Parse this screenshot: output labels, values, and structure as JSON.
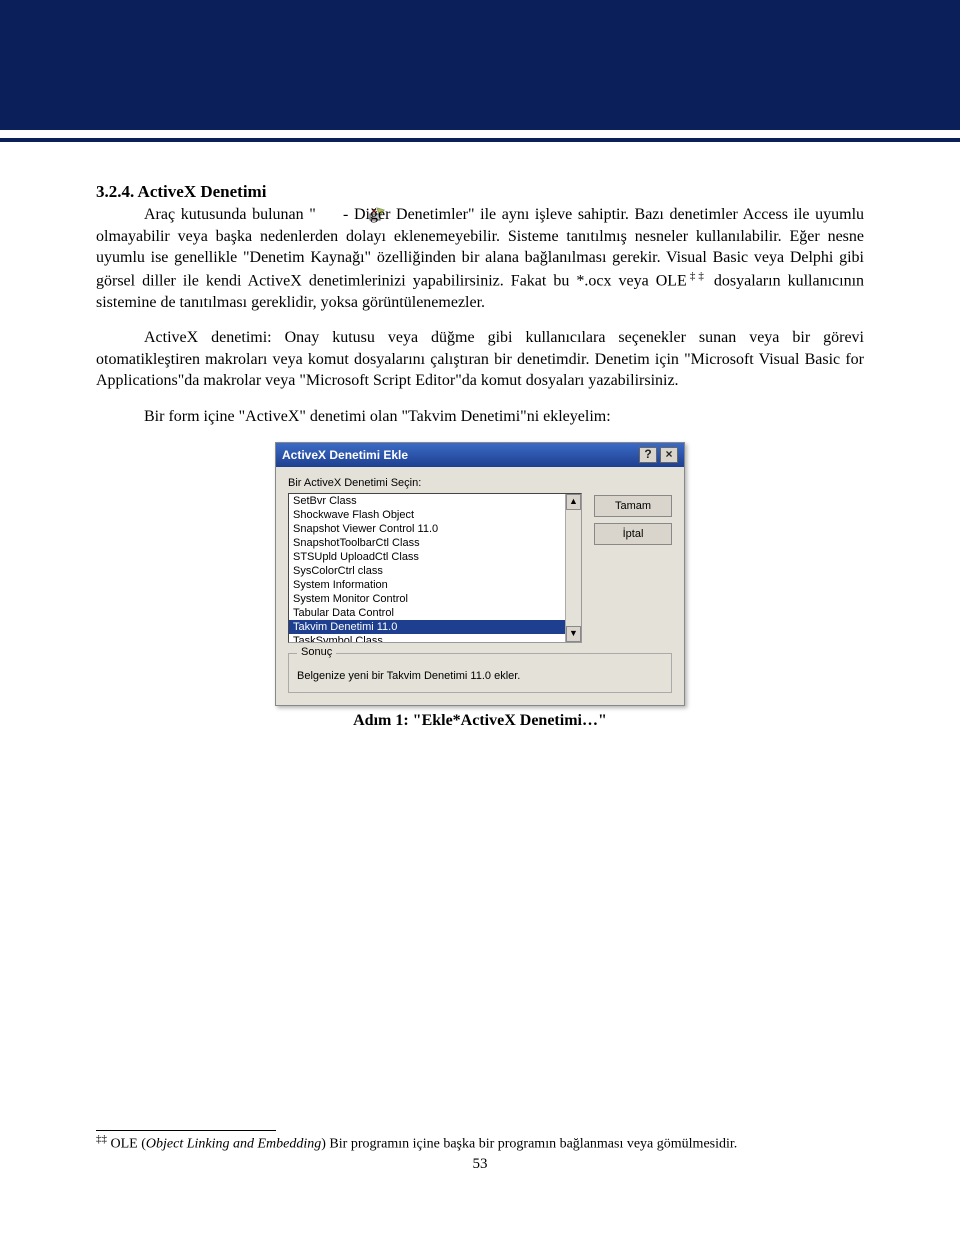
{
  "heading": "3.2.4. ActiveX Denetimi",
  "para1a": "Araç kutusunda bulunan \"",
  "para1b": " -  Diğer Denetimler\" ile aynı işleve sahiptir. Bazı denetimler Access ile uyumlu olmayabilir veya başka nedenlerden dolayı eklenemeyebilir. Sisteme tanıtılmış nesneler kullanılabilir. Eğer nesne uyumlu ise genellikle \"Denetim Kaynağı\" özelliğinden bir alana bağlanılması gerekir. Visual Basic veya Delphi gibi görsel diller ile kendi ActiveX denetimlerinizi yapabilirsiniz. Fakat bu *.ocx veya OLE",
  "para1c": " dosyaların kullanıcının sistemine de tanıtılması gereklidir, yoksa görüntülenemezler.",
  "fnote_marker": "‡‡",
  "para2": "ActiveX denetimi: Onay kutusu veya düğme gibi kullanıcılara seçenekler sunan veya bir görevi otomatikleştiren makroları veya komut dosyalarını çalıştıran bir denetimdir. Denetim için \"Microsoft Visual Basic for Applications\"da makrolar veya \"Microsoft Script Editor\"da komut dosyaları yazabilirsiniz.",
  "para3": "Bir form içine \"ActiveX\" denetimi olan \"Takvim Denetimi\"ni ekleyelim:",
  "caption": "Adım 1: \"Ekle*ActiveX Denetimi…\"",
  "dialog": {
    "title": "ActiveX Denetimi Ekle",
    "help": "?",
    "close": "×",
    "select_label": "Bir ActiveX Denetimi Seçin:",
    "items": [
      "SetBvr Class",
      "Shockwave Flash Object",
      "Snapshot Viewer Control 11.0",
      "SnapshotToolbarCtl Class",
      "STSUpld UploadCtl Class",
      "SysColorCtrl class",
      "System Information",
      "System Monitor Control",
      "Tabular Data Control",
      "Takvim Denetimi 11.0",
      "TaskSymbol Class"
    ],
    "selected_index": 9,
    "ok": "Tamam",
    "cancel": "İptal",
    "group_title": "Sonuç",
    "result_text": "Belgenize yeni bir Takvim Denetimi 11.0 ekler."
  },
  "footnote": {
    "marker": "‡‡",
    "acronym_plain": " OLE (",
    "acronym_italic": "Object Linking and Embedding",
    "rest": ") Bir programın içine başka bir programın bağlanması veya gömülmesidir."
  },
  "page_number": "53"
}
